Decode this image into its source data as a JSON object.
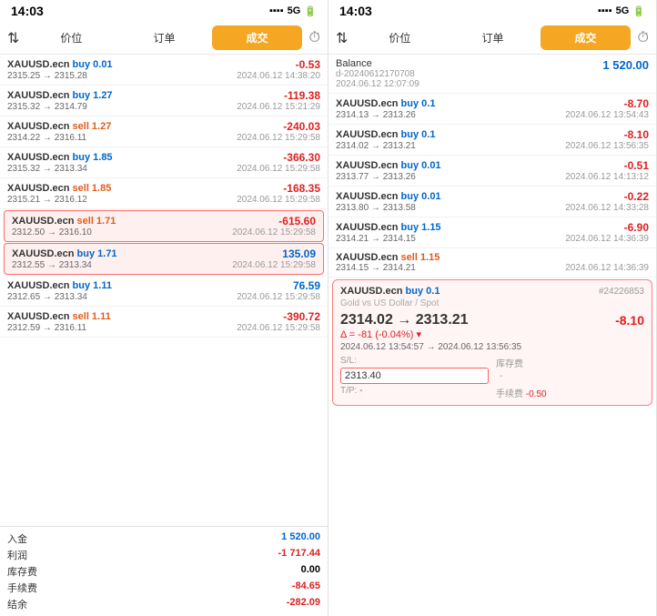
{
  "left_panel": {
    "status_time": "14:03",
    "signal": "5G",
    "tabs": [
      "价位",
      "订单",
      "成交"
    ],
    "active_tab": "成交",
    "trades": [
      {
        "symbol": "XAUUSD.ecn",
        "action": "buy",
        "volume": "0.01",
        "price_range": "2315.25 → 2315.28",
        "time": "2024.06.12 14:38:20",
        "pnl": "-0.53",
        "pnl_type": "neg"
      },
      {
        "symbol": "XAUUSD.ecn",
        "action": "buy",
        "volume": "1.27",
        "price_range": "2315.32 → 2314.79",
        "time": "2024.06.12 15:21:29",
        "pnl": "-119.38",
        "pnl_type": "neg"
      },
      {
        "symbol": "XAUUSD.ecn",
        "action": "sell",
        "volume": "1.27",
        "price_range": "2314.22 → 2316.11",
        "time": "2024.06.12 15:29:58",
        "pnl": "-240.03",
        "pnl_type": "neg"
      },
      {
        "symbol": "XAUUSD.ecn",
        "action": "buy",
        "volume": "1.85",
        "price_range": "2315.32 → 2313.34",
        "time": "2024.06.12 15:29:58",
        "pnl": "-366.30",
        "pnl_type": "neg"
      },
      {
        "symbol": "XAUUSD.ecn",
        "action": "sell",
        "volume": "1.85",
        "price_range": "2315.21 → 2316.12",
        "time": "2024.06.12 15:29:58",
        "pnl": "-168.35",
        "pnl_type": "neg"
      },
      {
        "symbol": "XAUUSD.ecn",
        "action": "sell",
        "volume": "1.71",
        "price_range": "2312.50 → 2316.10",
        "time": "2024.06.12 15:29:58",
        "pnl": "-615.60",
        "pnl_type": "neg",
        "highlighted": true
      },
      {
        "symbol": "XAUUSD.ecn",
        "action": "buy",
        "volume": "1.71",
        "price_range": "2312.55 → 2313.34",
        "time": "2024.06.12 15:29:58",
        "pnl": "135.09",
        "pnl_type": "pos",
        "highlighted": true
      },
      {
        "symbol": "XAUUSD.ecn",
        "action": "buy",
        "volume": "1.11",
        "price_range": "2312.65 → 2313.34",
        "time": "2024.06.12 15:29:58",
        "pnl": "76.59",
        "pnl_type": "pos"
      },
      {
        "symbol": "XAUUSD.ecn",
        "action": "sell",
        "volume": "1.11",
        "price_range": "2312.59 → 2316.11",
        "time": "2024.06.12 15:29:58",
        "pnl": "-390.72",
        "pnl_type": "neg"
      }
    ],
    "summary": [
      {
        "label": "入金",
        "value": "1 520.00",
        "type": "pos"
      },
      {
        "label": "利润",
        "value": "-1 717.44",
        "type": "neg"
      },
      {
        "label": "库存费",
        "value": "0.00",
        "type": "neutral"
      },
      {
        "label": "手续费",
        "value": "-84.65",
        "type": "neg"
      },
      {
        "label": "结余",
        "value": "-282.09",
        "type": "neg"
      }
    ]
  },
  "right_panel": {
    "status_time": "14:03",
    "signal": "5G",
    "tabs": [
      "价位",
      "订单",
      "成交"
    ],
    "active_tab": "成交",
    "balance": {
      "label": "Balance",
      "sub": "d-20240612170708",
      "value": "1 520.00",
      "time": "2024.06.12 12:07:09"
    },
    "trades": [
      {
        "symbol": "XAUUSD.ecn",
        "action": "buy",
        "volume": "0.1",
        "price_range": "2314.13 → 2313.26",
        "time": "2024.06.12 13:54:43",
        "pnl": "-8.70",
        "pnl_type": "neg"
      },
      {
        "symbol": "XAUUSD.ecn",
        "action": "buy",
        "volume": "0.1",
        "price_range": "2314.02 → 2313.21",
        "time": "2024.06.12 13:56:35",
        "pnl": "-8.10",
        "pnl_type": "neg"
      },
      {
        "symbol": "XAUUSD.ecn",
        "action": "buy",
        "volume": "0.01",
        "price_range": "2313.77 → 2313.26",
        "time": "2024.06.12 14:13:12",
        "pnl": "-0.51",
        "pnl_type": "neg"
      },
      {
        "symbol": "XAUUSD.ecn",
        "action": "buy",
        "volume": "0.01",
        "price_range": "2313.80 → 2313.58",
        "time": "2024.06.12 14:33:28",
        "pnl": "-0.22",
        "pnl_type": "neg"
      },
      {
        "symbol": "XAUUSD.ecn",
        "action": "buy",
        "volume": "1.15",
        "price_range": "2314.21 → 2314.15",
        "time": "2024.06.12 14:36:39",
        "pnl": "-6.90",
        "pnl_type": "neg"
      },
      {
        "symbol": "XAUUSD.ecn",
        "action": "sell",
        "volume": "1.15",
        "price_range": "2314.15 → 2314.21",
        "time": "2024.06.12 14:36:39",
        "pnl": "",
        "pnl_type": "neg"
      }
    ],
    "expanded_trade": {
      "symbol": "XAUUSD.ecn",
      "action": "buy",
      "volume": "0.1",
      "order_id": "#24226853",
      "subtitle": "Gold vs US Dollar / Spot",
      "price_from": "2314.02",
      "price_to": "2313.21",
      "delta": "Δ = -81 (-0.04%)",
      "time_range": "2024.06.12 13:54:57 → 2024.06.12 13:56:35",
      "pnl": "-8.10",
      "sl_label": "S/L:",
      "sl_value": "2313.40",
      "tp_label": "T/P:",
      "tp_value": "-",
      "storage_label": "库存费",
      "storage_value": "-",
      "fee_label": "手续费",
      "fee_value": "-0.50"
    }
  }
}
